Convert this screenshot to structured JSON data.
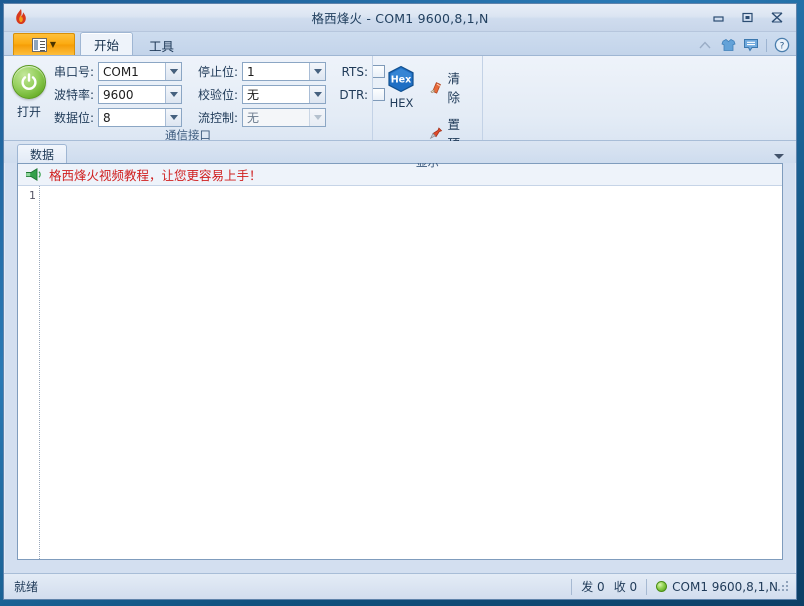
{
  "window": {
    "title": "格西烽火 - COM1  9600,8,1,N",
    "controls": {
      "minimize": "minimize",
      "maximize": "maximize",
      "close": "close"
    }
  },
  "ribbon": {
    "app_button": {
      "label": "",
      "icon": "document-menu-icon"
    },
    "tabs": [
      {
        "label": "开始",
        "active": true
      },
      {
        "label": "工具",
        "active": false
      }
    ],
    "quick_icons": [
      {
        "name": "minimize-ribbon-icon",
        "glyph": "⌃"
      },
      {
        "name": "skin-shirt-icon",
        "glyph": "shirt"
      },
      {
        "name": "feedback-icon",
        "glyph": "message"
      },
      {
        "name": "help-icon",
        "glyph": "?"
      }
    ],
    "groups": [
      {
        "name": "communication",
        "label": "通信接口",
        "power_button": {
          "label": "打开",
          "icon": "power-icon"
        },
        "fields": [
          {
            "label": "串口号:",
            "value": "COM1",
            "disabled": false
          },
          {
            "label": "波特率:",
            "value": "9600",
            "disabled": false
          },
          {
            "label": "数据位:",
            "value": "8",
            "disabled": false
          },
          {
            "label": "停止位:",
            "value": "1",
            "disabled": false
          },
          {
            "label": "校验位:",
            "value": "无",
            "disabled": false
          },
          {
            "label": "流控制:",
            "value": "无",
            "disabled": true
          }
        ],
        "checkboxes": [
          {
            "label": "RTS:",
            "checked": false
          },
          {
            "label": "DTR:",
            "checked": false
          }
        ]
      },
      {
        "name": "display",
        "label": "显示",
        "hex_button": {
          "label": "HEX",
          "badge": "Hex"
        },
        "buttons": [
          {
            "label": "清除",
            "icon": "eraser-icon"
          },
          {
            "label": "置顶",
            "icon": "pushpin-icon"
          }
        ]
      }
    ]
  },
  "document": {
    "tabs": [
      {
        "label": "数据",
        "active": true
      }
    ],
    "banner": {
      "icon": "megaphone-icon",
      "text": "格西烽火视频教程，让您更容易上手！",
      "color": "#d02020"
    },
    "editor": {
      "line_numbers": [
        "1"
      ],
      "content": ""
    }
  },
  "statusbar": {
    "status": "就绪",
    "sent_label": "发 0",
    "received_label": "收 0",
    "port": "COM1  9600,8,1,N",
    "led_color": "#8ed04e"
  },
  "colors": {
    "accent_orange": "#fbab11",
    "title_text": "#22405f",
    "banner_red": "#d02020",
    "ribbon_bg": "#e4ecf6"
  }
}
